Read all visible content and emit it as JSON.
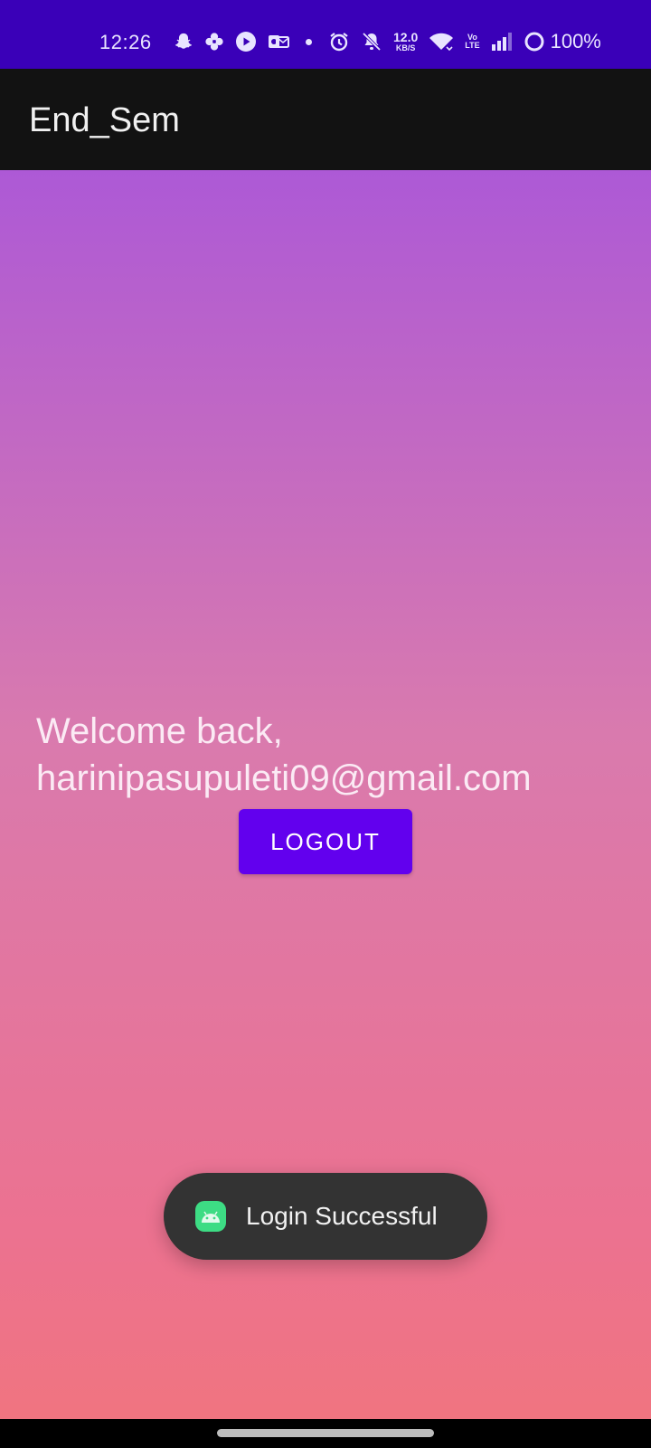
{
  "status_bar": {
    "time": "12:26",
    "net_speed_value": "12.0",
    "net_speed_unit": "KB/S",
    "volte_top": "Vo",
    "volte_bottom": "LTE",
    "battery": "100%",
    "icons": [
      "snapchat-icon",
      "pinwheel-icon",
      "play-icon",
      "outlook-icon",
      "dot-icon",
      "alarm-icon",
      "mute-icon",
      "wifi-icon",
      "signal-icon",
      "battery-ring-icon"
    ],
    "background_color": "#3a00b8"
  },
  "app_bar": {
    "title": "End_Sem",
    "background_color": "#121212"
  },
  "main": {
    "welcome_line1": "Welcome back,",
    "welcome_line2": "harinipasupuleti09@gmail.com",
    "logout_label": "LOGOUT",
    "button_color": "#6200ee",
    "gradient_colors": [
      "#ad59d6",
      "#d97aae",
      "#ec7290",
      "#f07480"
    ]
  },
  "toast": {
    "message": "Login Successful",
    "icon": "android-icon",
    "background_color": "#333333"
  }
}
